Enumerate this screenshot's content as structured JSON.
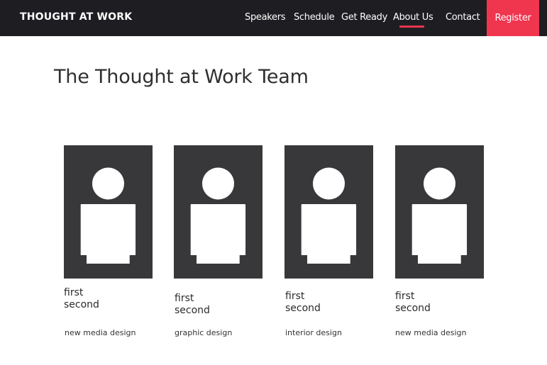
{
  "colors": {
    "nav_bg": "#1e1e22",
    "accent": "#f0354f",
    "avatar_bg": "#38383b"
  },
  "header": {
    "brand": "THOUGHT AT WORK",
    "nav": [
      {
        "label": "Speakers"
      },
      {
        "label": "Schedule"
      },
      {
        "label": "Get Ready"
      },
      {
        "label": "About Us",
        "active": true
      },
      {
        "label": "Contact"
      }
    ],
    "register_label": "Register"
  },
  "main": {
    "title": "The Thought at Work Team",
    "team": [
      {
        "icon": "person-icon",
        "first": "first",
        "last": "second",
        "role": "new media design"
      },
      {
        "icon": "person-icon",
        "first": "first",
        "last": "second",
        "role": "graphic design"
      },
      {
        "icon": "person-icon",
        "first": "first",
        "last": "second",
        "role": "interior design"
      },
      {
        "icon": "person-icon",
        "first": "first",
        "last": "second",
        "role": "new media design"
      }
    ]
  }
}
